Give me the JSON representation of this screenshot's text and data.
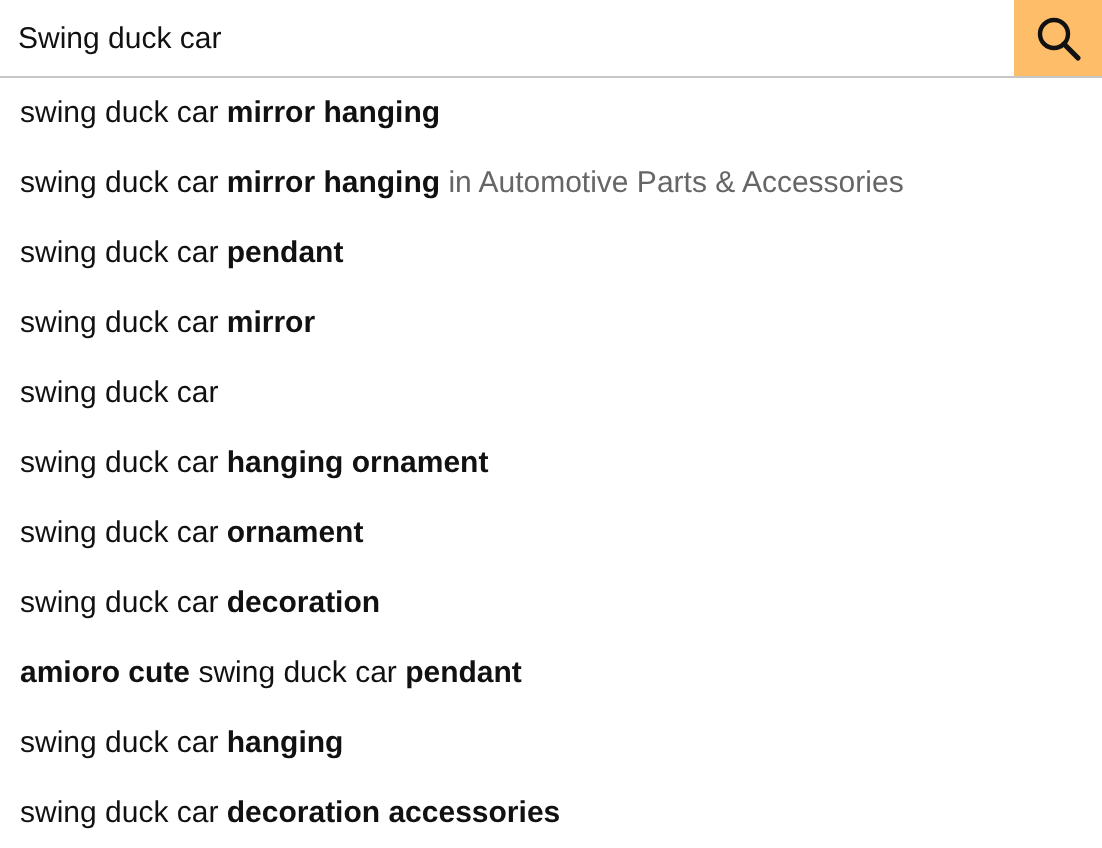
{
  "search": {
    "value": "Swing duck car"
  },
  "suggestions": [
    {
      "text": "swing duck car **mirror hanging**"
    },
    {
      "text": "swing duck car **mirror hanging**",
      "department": "in Automotive Parts & Accessories"
    },
    {
      "text": "swing duck car **pendant**"
    },
    {
      "text": "swing duck car **mirror**"
    },
    {
      "text": "swing duck car"
    },
    {
      "text": "swing duck car **hanging ornament**"
    },
    {
      "text": "swing duck car **ornament**"
    },
    {
      "text": "swing duck car **decoration**"
    },
    {
      "text": "**amioro cute** swing duck car **pendant**"
    },
    {
      "text": "swing duck car **hanging**"
    },
    {
      "text": "swing duck car **decoration accessories**"
    }
  ]
}
